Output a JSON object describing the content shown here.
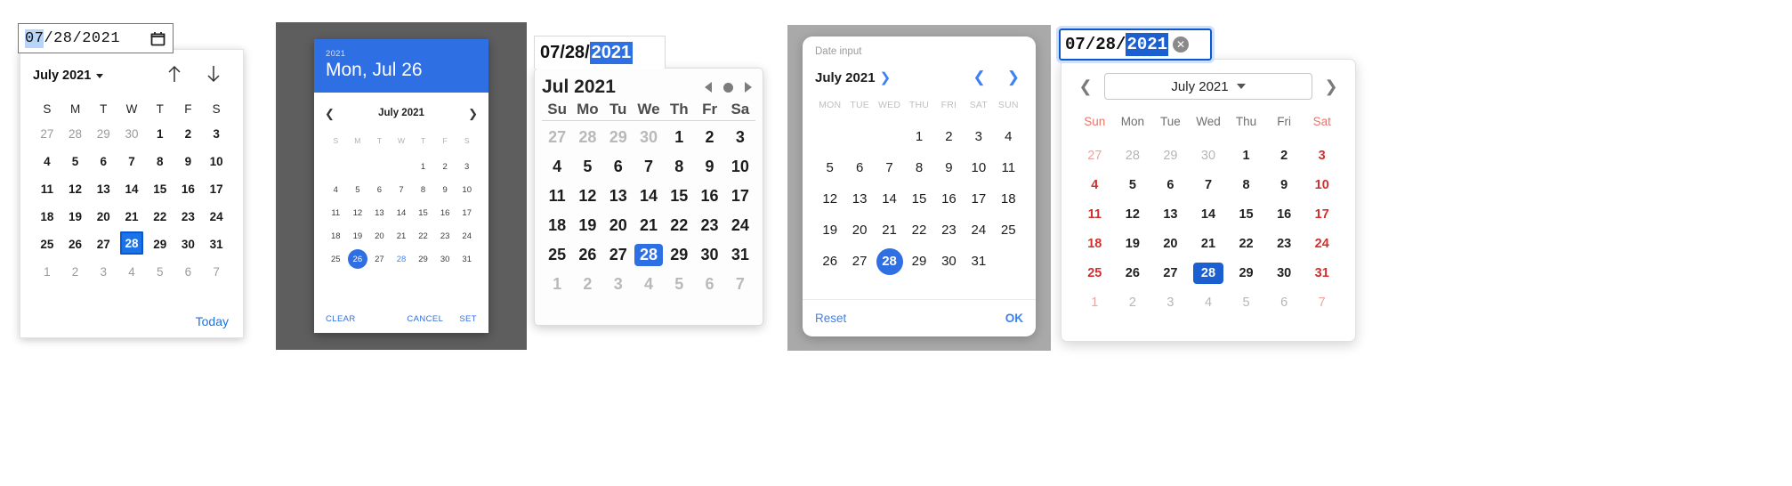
{
  "picker_chrome": {
    "name": "chrome-desktop-date-picker",
    "input": {
      "month": "07",
      "sep1": "/",
      "day": "28",
      "sep2": "/",
      "year": "2021",
      "selected_segment": "07",
      "icon": "calendar-icon"
    },
    "header": {
      "title": "July 2021",
      "caret": "chevron-down-icon",
      "prev_icon": "arrow-up-icon",
      "next_icon": "arrow-down-icon"
    },
    "dow": [
      "S",
      "M",
      "T",
      "W",
      "T",
      "F",
      "S"
    ],
    "weeks": [
      [
        {
          "d": "27",
          "o": true
        },
        {
          "d": "28",
          "o": true
        },
        {
          "d": "29",
          "o": true
        },
        {
          "d": "30",
          "o": true
        },
        {
          "d": "1"
        },
        {
          "d": "2"
        },
        {
          "d": "3"
        }
      ],
      [
        {
          "d": "4"
        },
        {
          "d": "5"
        },
        {
          "d": "6"
        },
        {
          "d": "7"
        },
        {
          "d": "8"
        },
        {
          "d": "9"
        },
        {
          "d": "10"
        }
      ],
      [
        {
          "d": "11"
        },
        {
          "d": "12"
        },
        {
          "d": "13"
        },
        {
          "d": "14"
        },
        {
          "d": "15"
        },
        {
          "d": "16"
        },
        {
          "d": "17"
        }
      ],
      [
        {
          "d": "18"
        },
        {
          "d": "19"
        },
        {
          "d": "20"
        },
        {
          "d": "21"
        },
        {
          "d": "22"
        },
        {
          "d": "23"
        },
        {
          "d": "24"
        }
      ],
      [
        {
          "d": "25"
        },
        {
          "d": "26"
        },
        {
          "d": "27"
        },
        {
          "d": "28",
          "s": true
        },
        {
          "d": "29"
        },
        {
          "d": "30"
        },
        {
          "d": "31"
        }
      ],
      [
        {
          "d": "1",
          "o": true
        },
        {
          "d": "2",
          "o": true
        },
        {
          "d": "3",
          "o": true
        },
        {
          "d": "4",
          "o": true
        },
        {
          "d": "5",
          "o": true
        },
        {
          "d": "6",
          "o": true
        },
        {
          "d": "7",
          "o": true
        }
      ]
    ],
    "footer": {
      "today_label": "Today"
    },
    "colors": {
      "accent": "#1a73e8",
      "selection": "#b7d4fb"
    }
  },
  "picker_material": {
    "name": "android-material-date-dialog",
    "header": {
      "year": "2021",
      "date": "Mon, Jul 26"
    },
    "nav": {
      "prev_icon": "chevron-left-icon",
      "month": "July 2021",
      "next_icon": "chevron-right-icon"
    },
    "dow": [
      "S",
      "M",
      "T",
      "W",
      "T",
      "F",
      "S"
    ],
    "weeks": [
      [
        {
          "d": ""
        },
        {
          "d": ""
        },
        {
          "d": ""
        },
        {
          "d": ""
        },
        {
          "d": "1"
        },
        {
          "d": "2"
        },
        {
          "d": "3"
        }
      ],
      [
        {
          "d": "4"
        },
        {
          "d": "5"
        },
        {
          "d": "6"
        },
        {
          "d": "7"
        },
        {
          "d": "8"
        },
        {
          "d": "9"
        },
        {
          "d": "10"
        }
      ],
      [
        {
          "d": "11"
        },
        {
          "d": "12"
        },
        {
          "d": "13"
        },
        {
          "d": "14"
        },
        {
          "d": "15"
        },
        {
          "d": "16"
        },
        {
          "d": "17"
        }
      ],
      [
        {
          "d": "18"
        },
        {
          "d": "19"
        },
        {
          "d": "20"
        },
        {
          "d": "21"
        },
        {
          "d": "22"
        },
        {
          "d": "23"
        },
        {
          "d": "24"
        }
      ],
      [
        {
          "d": "25"
        },
        {
          "d": "26",
          "s": true
        },
        {
          "d": "27"
        },
        {
          "d": "28",
          "t": true
        },
        {
          "d": "29"
        },
        {
          "d": "30"
        },
        {
          "d": "31"
        }
      ]
    ],
    "buttons": {
      "clear": "CLEAR",
      "cancel": "CANCEL",
      "set": "SET"
    },
    "colors": {
      "accent": "#2f6fe4",
      "backdrop": "#5e5e5e",
      "today": "#4285f4"
    }
  },
  "picker_safari": {
    "name": "safari-macos-date-picker",
    "input": {
      "month": "07",
      "sep1": "/",
      "day": "28",
      "sep2": "/",
      "year": "2021",
      "selected_segment": "2021"
    },
    "header": {
      "title": "Jul 2021",
      "prev_icon": "triangle-left-icon",
      "today_icon": "dot-icon",
      "next_icon": "triangle-right-icon"
    },
    "dow": [
      "Su",
      "Mo",
      "Tu",
      "We",
      "Th",
      "Fr",
      "Sa"
    ],
    "weeks": [
      [
        {
          "d": "27",
          "o": true
        },
        {
          "d": "28",
          "o": true
        },
        {
          "d": "29",
          "o": true
        },
        {
          "d": "30",
          "o": true
        },
        {
          "d": "1"
        },
        {
          "d": "2"
        },
        {
          "d": "3"
        }
      ],
      [
        {
          "d": "4"
        },
        {
          "d": "5"
        },
        {
          "d": "6"
        },
        {
          "d": "7"
        },
        {
          "d": "8"
        },
        {
          "d": "9"
        },
        {
          "d": "10"
        }
      ],
      [
        {
          "d": "11"
        },
        {
          "d": "12"
        },
        {
          "d": "13"
        },
        {
          "d": "14"
        },
        {
          "d": "15"
        },
        {
          "d": "16"
        },
        {
          "d": "17"
        }
      ],
      [
        {
          "d": "18"
        },
        {
          "d": "19"
        },
        {
          "d": "20"
        },
        {
          "d": "21"
        },
        {
          "d": "22"
        },
        {
          "d": "23"
        },
        {
          "d": "24"
        }
      ],
      [
        {
          "d": "25"
        },
        {
          "d": "26"
        },
        {
          "d": "27"
        },
        {
          "d": "28",
          "s": true
        },
        {
          "d": "29"
        },
        {
          "d": "30"
        },
        {
          "d": "31"
        }
      ],
      [
        {
          "d": "1",
          "o": true
        },
        {
          "d": "2",
          "o": true
        },
        {
          "d": "3",
          "o": true
        },
        {
          "d": "4",
          "o": true
        },
        {
          "d": "5",
          "o": true
        },
        {
          "d": "6",
          "o": true
        },
        {
          "d": "7",
          "o": true
        }
      ]
    ],
    "colors": {
      "accent": "#2f6fe4"
    }
  },
  "picker_sheet": {
    "name": "ios-date-input-sheet",
    "label": "Date input",
    "header": {
      "month": "July 2021",
      "month_arrow": "chevron-right-icon",
      "prev_icon": "chevron-left-icon",
      "next_icon": "chevron-right-icon"
    },
    "dow": [
      "MON",
      "TUE",
      "WED",
      "THU",
      "FRI",
      "SAT",
      "SUN"
    ],
    "weeks": [
      [
        {
          "d": ""
        },
        {
          "d": ""
        },
        {
          "d": ""
        },
        {
          "d": "1"
        },
        {
          "d": "2"
        },
        {
          "d": "3"
        },
        {
          "d": "4"
        }
      ],
      [
        {
          "d": "5"
        },
        {
          "d": "6"
        },
        {
          "d": "7"
        },
        {
          "d": "8"
        },
        {
          "d": "9"
        },
        {
          "d": "10"
        },
        {
          "d": "11"
        }
      ],
      [
        {
          "d": "12"
        },
        {
          "d": "13"
        },
        {
          "d": "14"
        },
        {
          "d": "15"
        },
        {
          "d": "16"
        },
        {
          "d": "17"
        },
        {
          "d": "18"
        }
      ],
      [
        {
          "d": "19"
        },
        {
          "d": "20"
        },
        {
          "d": "21"
        },
        {
          "d": "22"
        },
        {
          "d": "23"
        },
        {
          "d": "24"
        },
        {
          "d": "25"
        }
      ],
      [
        {
          "d": "26"
        },
        {
          "d": "27"
        },
        {
          "d": "28",
          "s": true
        },
        {
          "d": "29"
        },
        {
          "d": "30"
        },
        {
          "d": "31"
        },
        {
          "d": ""
        }
      ]
    ],
    "buttons": {
      "reset": "Reset",
      "ok": "OK"
    },
    "colors": {
      "accent": "#3b82f6",
      "selected": "#2f6fe4",
      "backdrop": "#a9a9a9"
    }
  },
  "picker_firefox": {
    "name": "firefox-windows-date-picker",
    "input": {
      "month": "07",
      "sep1": "/",
      "day": "28",
      "sep2": "/",
      "year": "2021",
      "selected_segment": "2021",
      "clear_icon": "clear-circle-icon"
    },
    "header": {
      "prev_icon": "chevron-left-icon",
      "month_select": "July 2021",
      "select_icon": "chevron-down-icon",
      "next_icon": "chevron-right-icon"
    },
    "dow": [
      "Sun",
      "Mon",
      "Tue",
      "Wed",
      "Thu",
      "Fri",
      "Sat"
    ],
    "weeks": [
      [
        {
          "d": "27",
          "o": true,
          "w": true
        },
        {
          "d": "28",
          "o": true
        },
        {
          "d": "29",
          "o": true
        },
        {
          "d": "30",
          "o": true
        },
        {
          "d": "1"
        },
        {
          "d": "2"
        },
        {
          "d": "3",
          "w": true
        }
      ],
      [
        {
          "d": "4",
          "w": true
        },
        {
          "d": "5"
        },
        {
          "d": "6"
        },
        {
          "d": "7"
        },
        {
          "d": "8"
        },
        {
          "d": "9"
        },
        {
          "d": "10",
          "w": true
        }
      ],
      [
        {
          "d": "11",
          "w": true
        },
        {
          "d": "12"
        },
        {
          "d": "13"
        },
        {
          "d": "14"
        },
        {
          "d": "15"
        },
        {
          "d": "16"
        },
        {
          "d": "17",
          "w": true
        }
      ],
      [
        {
          "d": "18",
          "w": true
        },
        {
          "d": "19"
        },
        {
          "d": "20"
        },
        {
          "d": "21"
        },
        {
          "d": "22"
        },
        {
          "d": "23"
        },
        {
          "d": "24",
          "w": true
        }
      ],
      [
        {
          "d": "25",
          "w": true
        },
        {
          "d": "26"
        },
        {
          "d": "27"
        },
        {
          "d": "28",
          "s": true
        },
        {
          "d": "29"
        },
        {
          "d": "30"
        },
        {
          "d": "31",
          "w": true
        }
      ],
      [
        {
          "d": "1",
          "o": true,
          "w": true
        },
        {
          "d": "2",
          "o": true
        },
        {
          "d": "3",
          "o": true
        },
        {
          "d": "4",
          "o": true
        },
        {
          "d": "5",
          "o": true
        },
        {
          "d": "6",
          "o": true
        },
        {
          "d": "7",
          "o": true,
          "w": true
        }
      ]
    ],
    "colors": {
      "accent": "#1b5fd0",
      "weekend": "#d32f2f",
      "focus_ring": "#cfe0fb"
    }
  }
}
